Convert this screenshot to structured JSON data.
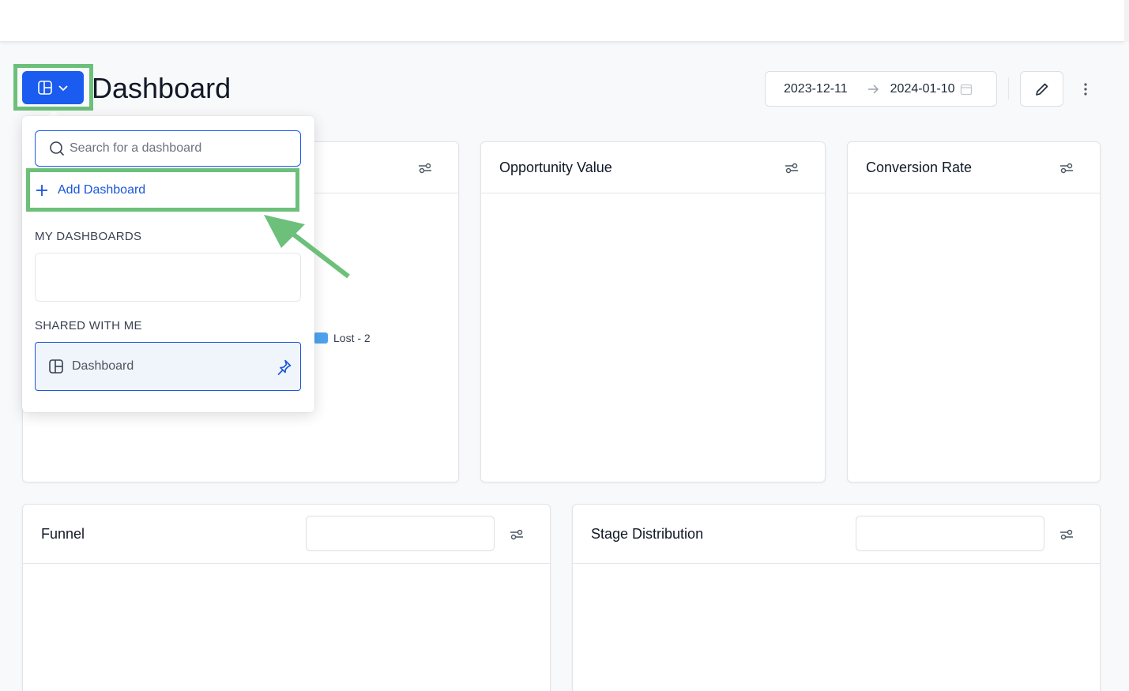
{
  "header": {
    "title": "Dashboard",
    "date_start": "2023-12-11",
    "date_end": "2024-01-10"
  },
  "dropdown": {
    "search_placeholder": "Search for a dashboard",
    "add_label": "Add Dashboard",
    "my_dashboards_label": "MY DASHBOARDS",
    "shared_label": "SHARED WITH ME",
    "shared_items": [
      {
        "label": "Dashboard"
      }
    ]
  },
  "cards": {
    "first_legend": "Lost - 2",
    "opportunity_value": "Opportunity Value",
    "conversion_rate": "Conversion Rate",
    "funnel": "Funnel",
    "stage_distribution": "Stage Distribution"
  },
  "colors": {
    "primary": "#1a5cf0",
    "highlight": "#6cc07a",
    "legend_lost": "#4ea3ef"
  },
  "icons": [
    "dashboard-layout-icon",
    "chevron-down-icon",
    "arrow-right-icon",
    "calendar-icon",
    "pencil-icon",
    "more-vertical-icon",
    "filter-settings-icon",
    "search-icon",
    "plus-icon",
    "pin-icon"
  ]
}
